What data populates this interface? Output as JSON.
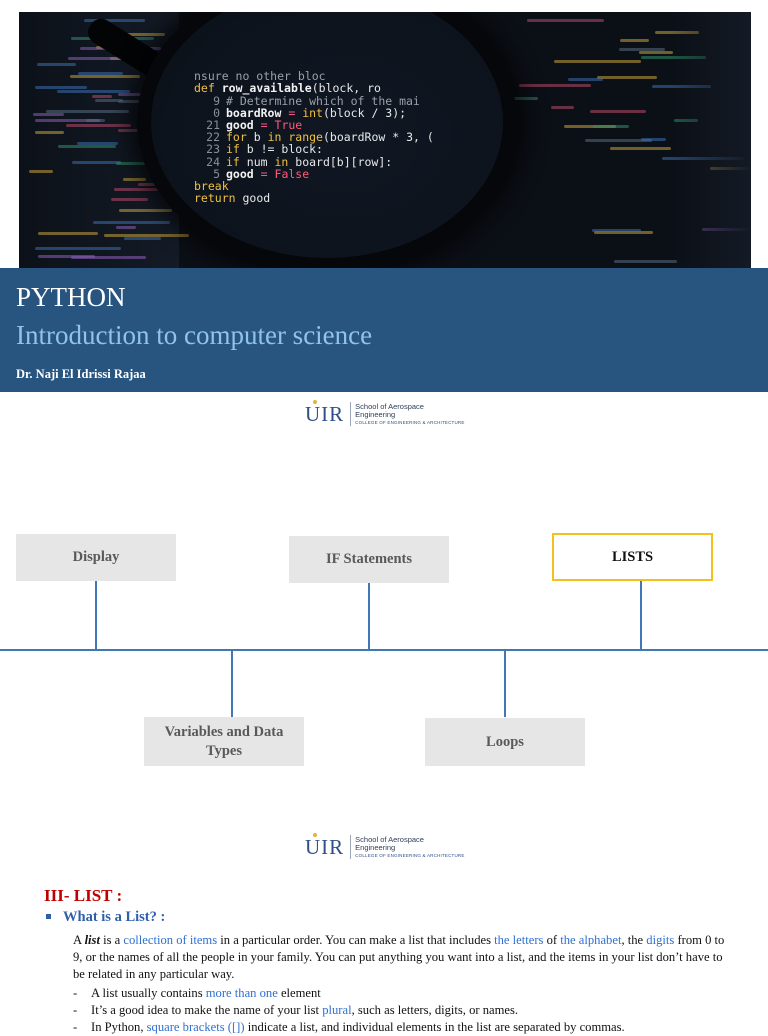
{
  "hero": {
    "code_lines": [
      {
        "num": "",
        "html": "nsure no other bloc"
      },
      {
        "num": "",
        "text": "def row_available(block, row"
      },
      {
        "num": "9",
        "text": "# Determine which of the main"
      },
      {
        "num": "0",
        "text": "boardRow = int(block / 3);"
      },
      {
        "num": "21",
        "text": "good = True"
      },
      {
        "num": "22",
        "text": "for b in range(boardRow * 3, ("
      },
      {
        "num": "23",
        "text": "if b != block:"
      },
      {
        "num": "24",
        "text": "if num in board[b][row]:"
      },
      {
        "num": "5",
        "text": "good = False"
      },
      {
        "num": "",
        "text": "break"
      },
      {
        "num": "",
        "text": "return good"
      }
    ]
  },
  "banner": {
    "title": "PYTHON",
    "subtitle": "Introduction to computer science",
    "author": "Dr. Naji El Idrissi Rajaa"
  },
  "logo": {
    "mark": "UIR",
    "line1": "School of Aerospace",
    "line2": "Engineering",
    "line3": "COLLEGE OF ENGINEERING & ARCHITECTURE"
  },
  "timeline": {
    "top": [
      "Display",
      "IF Statements",
      "LISTS"
    ],
    "bottom": [
      "Variables and Data Types",
      "Loops"
    ],
    "active": "LISTS"
  },
  "document": {
    "section": "III- LIST :",
    "subsection": "What is a List? :",
    "para": {
      "p1": "A ",
      "p2": "list",
      "p3": " is a ",
      "p4": "collection of items",
      "p5": " in a particular order. You can make a list that includes ",
      "p6": "the letters",
      "p7": " of ",
      "p8": "the alphabet",
      "p9": ", the ",
      "p10": "digits",
      "p11": " from 0 to 9, or the names of all the people in your family. You can put anything you want into a list, and the items in your list don’t have to be related in any particular way."
    },
    "bullets": [
      {
        "a": "A list usually contains ",
        "b": "more than one",
        "c": " element"
      },
      {
        "a": "It’s a good idea to make the name of your list ",
        "b": "plural",
        "c": ", such as letters, digits, or names."
      },
      {
        "a": "In Python, ",
        "b": "square brackets ([])",
        "c": " indicate a list, and individual elements in the list are separated by commas."
      }
    ]
  },
  "colors": {
    "banner_bg": "#285480",
    "subtitle": "#8fc3ea",
    "timeline_line": "#3f78b4",
    "active_border": "#f2c21b",
    "section_red": "#c00000",
    "link_blue": "#2e6fd0"
  }
}
